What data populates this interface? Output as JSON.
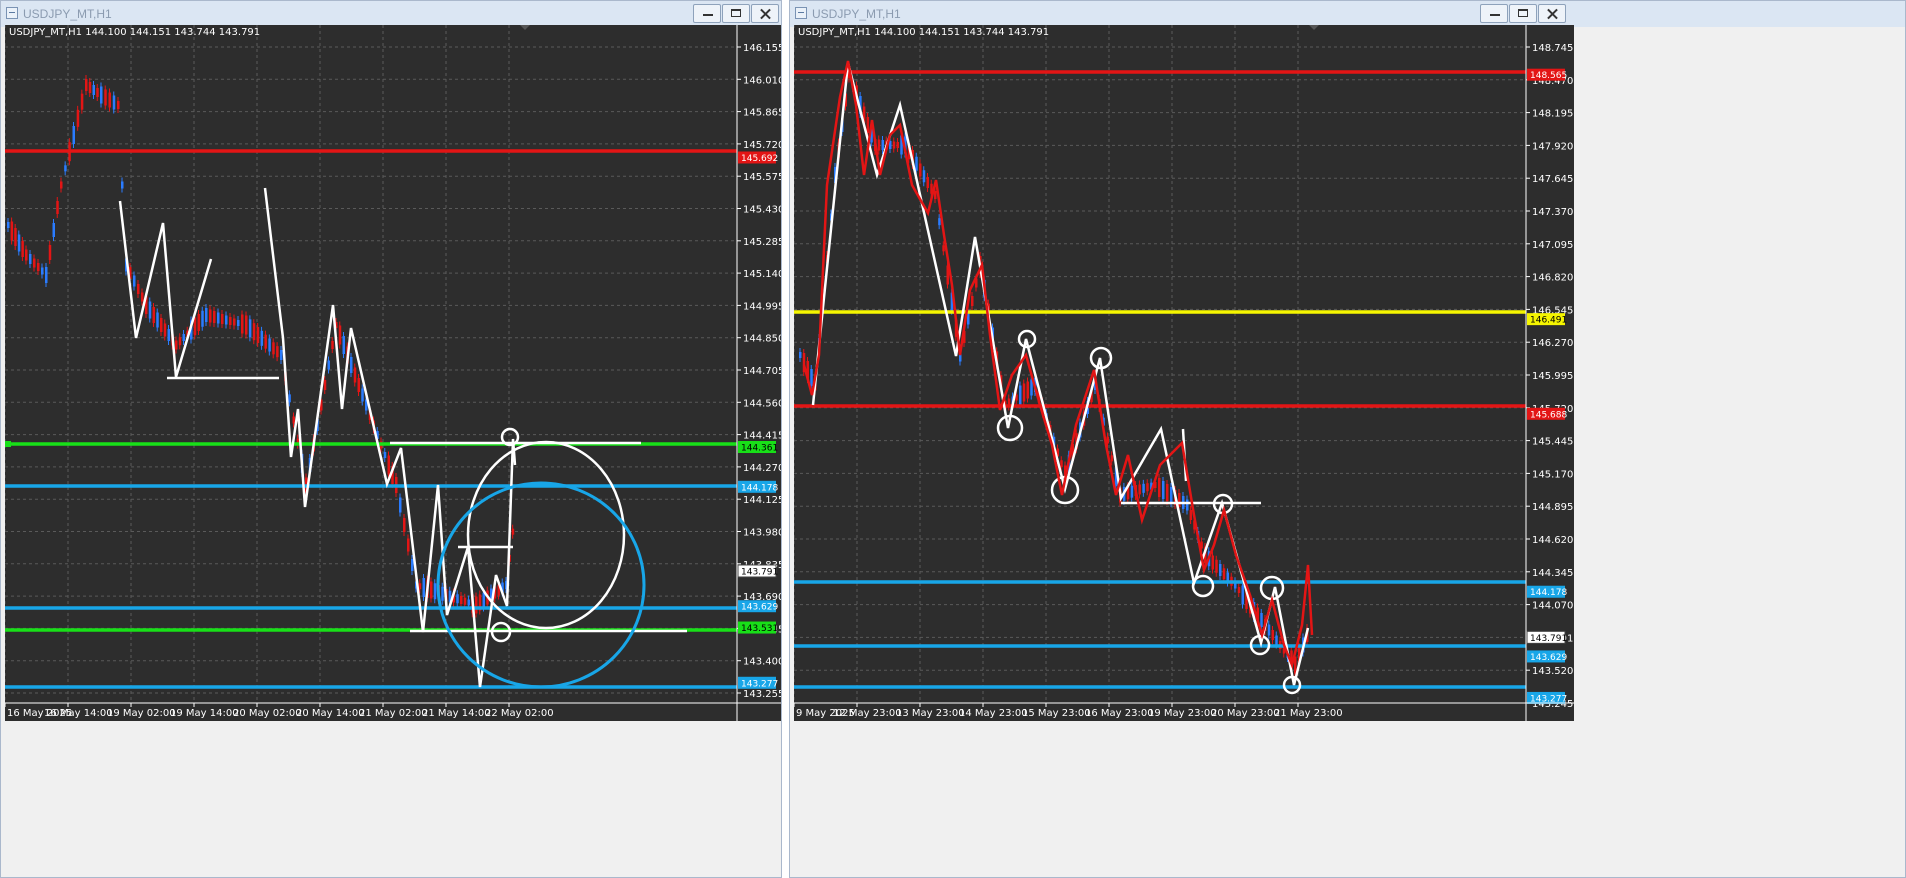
{
  "windows": [
    {
      "title": "USDJPY_MT,H1",
      "header_text": "USDJPY_MT,H1  144.100 144.151 143.744 143.791",
      "price_axis": [
        "146.155",
        "146.010",
        "145.865",
        "145.720",
        "145.575",
        "145.430",
        "145.285",
        "145.140",
        "144.995",
        "144.850",
        "144.705",
        "144.560",
        "144.415",
        "144.270",
        "144.125",
        "143.980",
        "143.835",
        "143.690",
        "143.545",
        "143.400",
        "143.255"
      ],
      "time_axis": [
        "16 May 2025",
        "16 May 14:00",
        "19 May 02:00",
        "19 May 14:00",
        "20 May 02:00",
        "20 May 14:00",
        "21 May 02:00",
        "21 May 14:00",
        "22 May 02:00"
      ],
      "level_badges": [
        {
          "value": "145.692",
          "color": "#e31515"
        },
        {
          "value": "144.361",
          "color": "#18e018"
        },
        {
          "value": "144.178",
          "color": "#18a6e8"
        },
        {
          "value": "143.791",
          "color": "#ffffff"
        },
        {
          "value": "143.629",
          "color": "#18a6e8"
        },
        {
          "value": "143.531",
          "color": "#18e018"
        },
        {
          "value": "143.277",
          "color": "#18a6e8"
        }
      ]
    },
    {
      "title": "USDJPY_MT,H1",
      "header_text": "USDJPY_MT,H1  144.100 144.151 143.744 143.791",
      "price_axis": [
        "148.745",
        "148.470",
        "148.195",
        "147.920",
        "147.645",
        "147.370",
        "147.095",
        "146.820",
        "146.545",
        "146.270",
        "145.995",
        "145.720",
        "145.445",
        "145.170",
        "144.895",
        "144.620",
        "144.345",
        "144.070",
        "143.791",
        "143.520",
        "143.245"
      ],
      "time_axis": [
        "9 May 2025",
        "12 May 23:00",
        "13 May 23:00",
        "14 May 23:00",
        "15 May 23:00",
        "16 May 23:00",
        "19 May 23:00",
        "20 May 23:00",
        "21 May 23:00"
      ],
      "level_badges": [
        {
          "value": "148.565",
          "color": "#e31515"
        },
        {
          "value": "146.491",
          "color": "#f5f500"
        },
        {
          "value": "145.688",
          "color": "#e31515"
        },
        {
          "value": "144.178",
          "color": "#18a6e8"
        },
        {
          "value": "143.791",
          "color": "#ffffff"
        },
        {
          "value": "143.629",
          "color": "#18a6e8"
        },
        {
          "value": "143.277",
          "color": "#18a6e8"
        }
      ]
    }
  ],
  "chart_data": [
    {
      "type": "candlestick",
      "symbol": "USDJPY_MT",
      "timeframe": "H1",
      "ohlc_last": {
        "open": 144.1,
        "high": 144.151,
        "low": 143.744,
        "close": 143.791
      },
      "ylim": [
        143.23,
        146.2
      ],
      "ytick_step": 0.145,
      "horizontal_levels": [
        {
          "price": 145.692,
          "color": "#e31515"
        },
        {
          "price": 144.361,
          "color": "#18e018"
        },
        {
          "price": 144.178,
          "color": "#18a6e8"
        },
        {
          "price": 143.629,
          "color": "#18a6e8"
        },
        {
          "price": 143.531,
          "color": "#18e018"
        },
        {
          "price": 143.277,
          "color": "#18a6e8"
        }
      ],
      "current_price": 143.791,
      "grid": true
    },
    {
      "type": "candlestick",
      "symbol": "USDJPY_MT",
      "timeframe": "H1",
      "ohlc_last": {
        "open": 144.1,
        "high": 144.151,
        "low": 143.744,
        "close": 143.791
      },
      "ylim": [
        143.2,
        148.8
      ],
      "ytick_step": 0.275,
      "horizontal_levels": [
        {
          "price": 148.565,
          "color": "#e31515"
        },
        {
          "price": 146.491,
          "color": "#f5f500"
        },
        {
          "price": 145.688,
          "color": "#e31515"
        },
        {
          "price": 144.178,
          "color": "#18a6e8"
        },
        {
          "price": 143.629,
          "color": "#18a6e8"
        },
        {
          "price": 143.277,
          "color": "#18a6e8"
        }
      ],
      "current_price": 143.791,
      "grid": true
    }
  ]
}
